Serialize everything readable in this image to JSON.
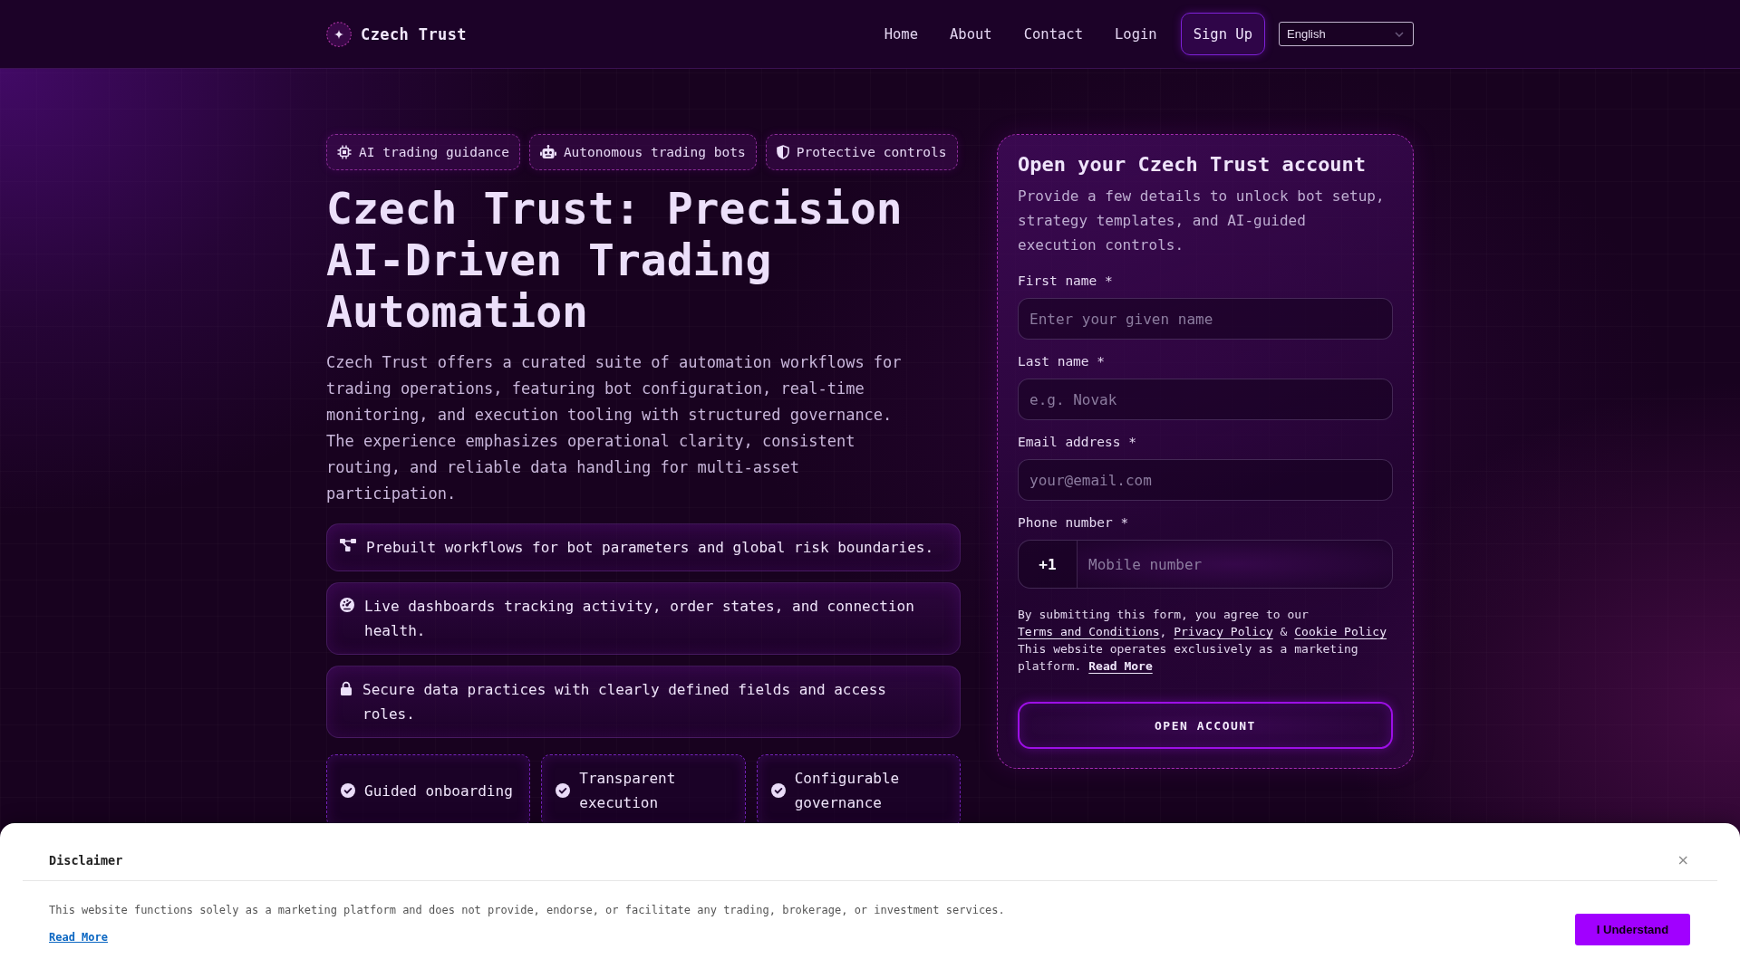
{
  "header": {
    "brand": "Czech Trust",
    "nav": [
      {
        "label": "Home"
      },
      {
        "label": "About"
      },
      {
        "label": "Contact"
      },
      {
        "label": "Login"
      }
    ],
    "signup_button": "Sign Up",
    "language": "English"
  },
  "hero": {
    "badges": [
      "AI trading guidance",
      "Autonomous trading bots",
      "Protective controls"
    ],
    "title": "Czech Trust: Precision AI-Driven Trading Automation",
    "description": "Czech Trust offers a curated suite of automation workflows for trading operations, featuring bot configuration, real-time monitoring, and execution tooling with structured governance. The experience emphasizes operational clarity, consistent routing, and reliable data handling for multi-asset participation.",
    "features": [
      "Prebuilt workflows for bot parameters and global risk boundaries.",
      "Live dashboards tracking activity, order states, and connection health.",
      "Secure data practices with clearly defined fields and access roles."
    ],
    "highlights": [
      "Guided onboarding",
      "Transparent execution",
      "Configurable governance"
    ]
  },
  "signup_form": {
    "title": "Open your Czech Trust account",
    "subtitle": "Provide a few details to unlock bot setup, strategy templates, and AI-guided execution controls.",
    "fields": [
      {
        "kind": "text",
        "label": "First name *",
        "placeholder": "Enter your given name"
      },
      {
        "kind": "text",
        "label": "Last name *",
        "placeholder": "e.g. Novak"
      },
      {
        "kind": "email",
        "label": "Email address *",
        "placeholder": "your@email.com"
      },
      {
        "kind": "phone",
        "label": "Phone number *",
        "prefix": "+1",
        "placeholder": "Mobile number"
      }
    ],
    "consent": [
      {
        "kind": "text",
        "text": "By submitting this form, you agree to our "
      },
      {
        "kind": "link",
        "text": "Terms and Conditions"
      },
      {
        "kind": "text",
        "text": ", "
      },
      {
        "kind": "link",
        "text": "Privacy Policy"
      },
      {
        "kind": "text",
        "text": " & "
      },
      {
        "kind": "link",
        "text": "Cookie Policy"
      }
    ],
    "notice": [
      {
        "kind": "text",
        "text": "This website operates exclusively as a marketing platform. "
      },
      {
        "kind": "strong_link",
        "text": "Read More"
      }
    ],
    "submit": "OPEN ACCOUNT"
  },
  "disclaimer": {
    "title": "Disclaimer",
    "close": "×",
    "text": "This website functions solely as a marketing platform and does not provide, endorse, or facilitate any trading, brokerage, or investment services.",
    "link": "Read More",
    "button": "I Understand"
  }
}
